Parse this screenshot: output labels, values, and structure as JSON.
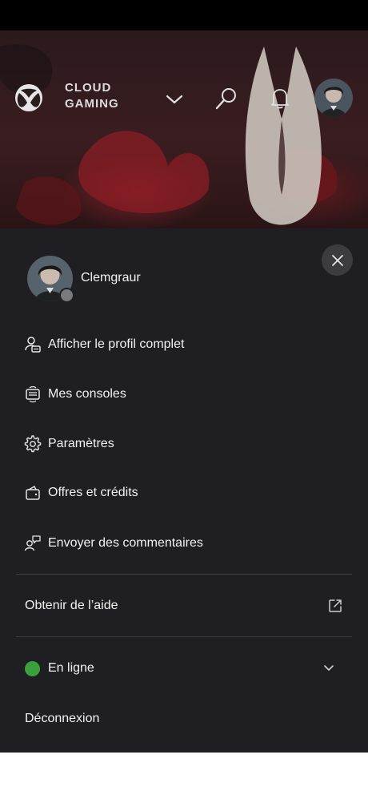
{
  "header": {
    "title_line1": "CLOUD",
    "title_line2": "GAMING"
  },
  "profile": {
    "gamertag": "Clemgraur",
    "presence_color": "#7a7a7e"
  },
  "menu": {
    "items": [
      {
        "label": "Afficher le profil complet",
        "icon": "profile-card-icon"
      },
      {
        "label": "Mes consoles",
        "icon": "console-icon"
      },
      {
        "label": "Paramètres",
        "icon": "gear-icon"
      },
      {
        "label": "Offres et crédits",
        "icon": "wallet-icon"
      },
      {
        "label": "Envoyer des commentaires",
        "icon": "feedback-icon"
      }
    ],
    "help_label": "Obtenir de l’aide",
    "status_label": "En ligne",
    "status_color": "#3aa13a",
    "logout_label": "Déconnexion"
  },
  "colors": {
    "panel_bg": "#1f1f23",
    "accent_green": "#3aa13a"
  }
}
